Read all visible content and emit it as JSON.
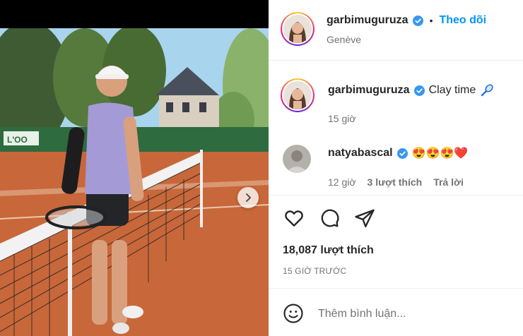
{
  "post": {
    "author": {
      "username": "garbimuguruza",
      "location": "Genève",
      "follow_label": "Theo dõi",
      "separator": "•"
    },
    "caption": {
      "username": "garbimuguruza",
      "text": "Clay time",
      "emoji_icon": "tennis-racket-icon",
      "time": "15 giờ"
    },
    "comments": [
      {
        "username": "natyabascal",
        "text": "😍😍😍❤️",
        "time": "12 giờ",
        "likes": "3 lượt thích",
        "reply_label": "Trả lời"
      }
    ],
    "likes": "18,087 lượt thích",
    "posted": "15 GIỜ TRƯỚC",
    "comment_placeholder": "Thêm bình luận..."
  },
  "colors": {
    "accent": "#0095f6",
    "verified": "#3897f0",
    "clay": "#c8673a"
  },
  "icons": [
    "like-icon",
    "comment-icon",
    "share-icon",
    "emoji-icon",
    "next-arrow-icon",
    "verified-icon"
  ]
}
